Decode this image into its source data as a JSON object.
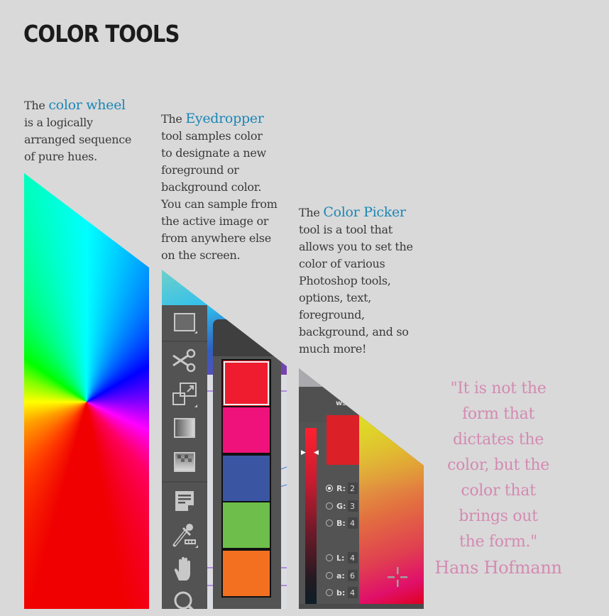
{
  "page": {
    "title": "COLOR TOOLS",
    "background": "#d9d9d9",
    "accent_color": "#1a86b5",
    "quote_color": "#d48ab2"
  },
  "color_wheel": {
    "intro": "The",
    "highlight": "color wheel",
    "lines": [
      "is a logically",
      "arranged sequence",
      "of pure hues."
    ]
  },
  "eyedropper": {
    "intro": "The",
    "highlight": "Eyedropper",
    "lines": [
      "tool samples color",
      "to designate a new",
      "foreground or",
      "background color.",
      "You can sample from",
      "the active image or",
      "from anywhere else",
      "on the screen."
    ],
    "toolbar_icons": [
      "rectangle-marquee-icon",
      "scissors-icon",
      "transform-icon",
      "gradient-icon",
      "pattern-icon",
      "notes-icon",
      "eyedropper-icon",
      "hand-icon",
      "zoom-icon"
    ],
    "swatches": [
      {
        "name": "red",
        "color": "#ee1c2e"
      },
      {
        "name": "magenta",
        "color": "#ee127a"
      },
      {
        "name": "blue",
        "color": "#3a56a3"
      },
      {
        "name": "green",
        "color": "#6dbe4b"
      },
      {
        "name": "orange",
        "color": "#f37021"
      }
    ]
  },
  "color_picker": {
    "intro": "The",
    "highlight": "Color Picker",
    "lines": [
      "tool is a tool that",
      "allows you to set the",
      "color of various",
      "Photoshop tools,",
      "options, text,",
      "foreground,",
      "background, and so",
      "much more!"
    ],
    "header_text": "ws",
    "new_color": "#db2027",
    "fields": [
      {
        "label": "R:",
        "value": "2",
        "selected": true
      },
      {
        "label": "G:",
        "value": "3",
        "selected": false
      },
      {
        "label": "B:",
        "value": "4",
        "selected": false
      },
      {
        "label": "L:",
        "value": "4",
        "selected": false
      },
      {
        "label": "a:",
        "value": "6",
        "selected": false
      },
      {
        "label": "b:",
        "value": "4",
        "selected": false
      }
    ]
  },
  "quote": {
    "lines": [
      "\"It is not the",
      "form that",
      "dictates the",
      "color, but the",
      "color that",
      "brings out",
      "the form.\""
    ],
    "author": "Hans Hofmann"
  }
}
